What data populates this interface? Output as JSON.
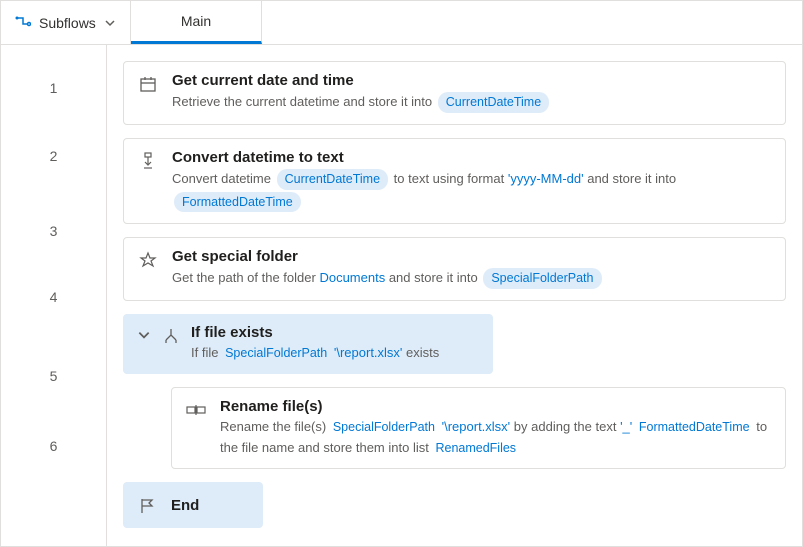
{
  "header": {
    "subflows_label": "Subflows",
    "tab_label": "Main"
  },
  "lines": {
    "l1": "1",
    "l2": "2",
    "l3": "3",
    "l4": "4",
    "l5": "5",
    "l6": "6"
  },
  "actions": {
    "a1": {
      "title": "Get current date and time",
      "desc_prefix": "Retrieve the current datetime and store it into",
      "var": "CurrentDateTime"
    },
    "a2": {
      "title": "Convert datetime to text",
      "p1": "Convert datetime",
      "var1": "CurrentDateTime",
      "p2": "to text using format",
      "fmt": "'yyyy-MM-dd'",
      "p3": "and store it into",
      "var2": "FormattedDateTime"
    },
    "a3": {
      "title": "Get special folder",
      "p1": "Get the path of the folder",
      "folder": "Documents",
      "p2": "and store it into",
      "var": "SpecialFolderPath"
    },
    "a4": {
      "title": "If file exists",
      "p1": "If file",
      "var": "SpecialFolderPath",
      "path": "'\\report.xlsx'",
      "p2": "exists"
    },
    "a5": {
      "title": "Rename file(s)",
      "p1": "Rename the file(s)",
      "var1": "SpecialFolderPath",
      "path": "'\\report.xlsx'",
      "p2": "by adding the text",
      "sep": "'_'",
      "var2": "FormattedDateTime",
      "p3": "to the file name and store them into list",
      "var3": "RenamedFiles"
    },
    "a6": {
      "title": "End"
    }
  }
}
